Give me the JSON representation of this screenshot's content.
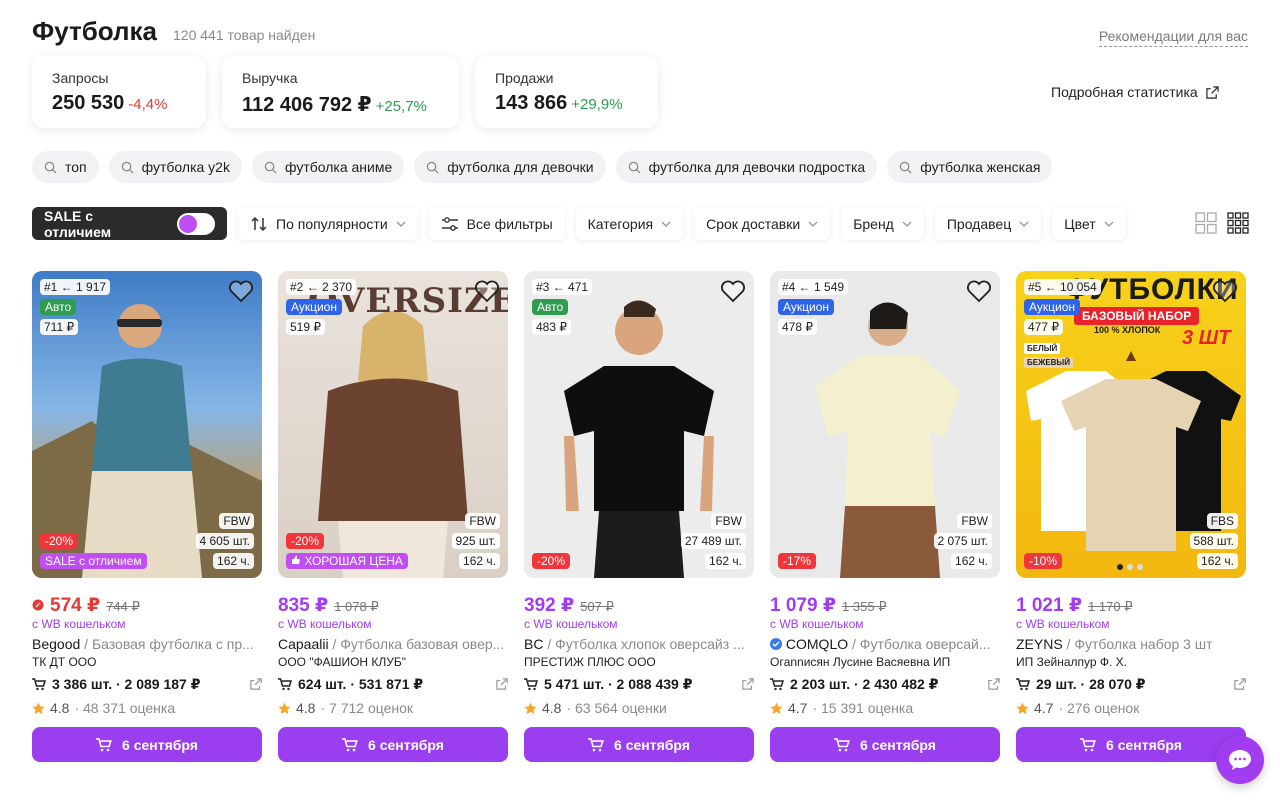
{
  "header": {
    "title": "Футболка",
    "found": "120 441 товар найден",
    "recommendations": "Рекомендации для вас"
  },
  "stats": [
    {
      "label": "Запросы",
      "value": "250 530",
      "change": "-4,4%"
    },
    {
      "label": "Выручка",
      "value": "112 406 792 ₽",
      "change": "+25,7%"
    },
    {
      "label": "Продажи",
      "value": "143 866",
      "change": "+29,9%"
    }
  ],
  "detailed_stats": "Подробная статистика",
  "chips": [
    "топ",
    "футболка y2k",
    "футболка аниме",
    "футболка для девочки",
    "футболка для девочки подростка",
    "футболка женская"
  ],
  "filters": {
    "sale_toggle": "SALE с отличием",
    "sort": "По популярности",
    "all_filters": "Все фильтры",
    "category": "Категория",
    "delivery": "Срок доставки",
    "brand": "Бренд",
    "seller": "Продавец",
    "color": "Цвет"
  },
  "products": [
    {
      "rank": "#1 ← 1 917",
      "promo": "Авто",
      "small_price": "711 ₽",
      "model": "FBW",
      "stock": "4 605 шт.",
      "hours": "162 ч.",
      "discount": "-20%",
      "badge": "SALE с отличием",
      "price": "574 ₽",
      "old_price": "744 ₽",
      "wallet": "с WB кошельком",
      "brand": "Begood",
      "name": "/ Базовая футболка с пр...",
      "seller": "ТК ДТ ООО",
      "sales": "3 386 шт. · 2 089 187 ₽",
      "rating": "4.8",
      "reviews": "· 48 371 оценка",
      "delivery": "6 сентября"
    },
    {
      "rank": "#2 ← 2 370",
      "promo": "Аукцион",
      "small_price": "519 ₽",
      "model": "FBW",
      "stock": "925 шт.",
      "hours": "162 ч.",
      "discount": "-20%",
      "badge": "ХОРОШАЯ ЦЕНА",
      "price": "835 ₽",
      "old_price": "1 078 ₽",
      "wallet": "с WB кошельком",
      "brand": "Capaalii",
      "name": "/ Футболка базовая овер...",
      "seller": "ООО \"ФАШИОН КЛУБ\"",
      "sales": "624 шт. · 531 871 ₽",
      "rating": "4.8",
      "reviews": "· 7 712 оценок",
      "delivery": "6 сентября",
      "banner": "OVERSIZE"
    },
    {
      "rank": "#3 ← 471",
      "promo": "Авто",
      "small_price": "483 ₽",
      "model": "FBW",
      "stock": "27 489 шт.",
      "hours": "162 ч.",
      "discount": "-20%",
      "price": "392 ₽",
      "old_price": "507 ₽",
      "wallet": "с WB кошельком",
      "brand": "BC",
      "name": "/ Футболка хлопок оверсайз ...",
      "seller": "ПРЕСТИЖ ПЛЮС ООО",
      "sales": "5 471 шт. · 2 088 439 ₽",
      "rating": "4.8",
      "reviews": "· 63 564 оценки",
      "delivery": "6 сентября"
    },
    {
      "rank": "#4 ← 1 549",
      "promo": "Аукцион",
      "small_price": "478 ₽",
      "model": "FBW",
      "stock": "2 075 шт.",
      "hours": "162 ч.",
      "discount": "-17%",
      "price": "1 079 ₽",
      "old_price": "1 355 ₽",
      "wallet": "с WB кошельком",
      "brand": "COMQLO",
      "name": "/ Футболка оверсай...",
      "seller": "Огannисян Лусине Васяевна ИП",
      "sales": "2 203 шт. · 2 430 482 ₽",
      "rating": "4.7",
      "reviews": "· 15 391 оценка",
      "delivery": "6 сентября"
    },
    {
      "rank": "#5 ← 10 054",
      "promo": "Аукцион",
      "small_price": "477 ₽",
      "model": "FBS",
      "stock": "588 шт.",
      "hours": "162 ч.",
      "discount": "-10%",
      "price": "1 021 ₽",
      "old_price": "1 170 ₽",
      "wallet": "с WB кошельком",
      "brand": "ZEYNS",
      "name": "/ Футболка набор 3 шт",
      "seller": "ИП Зейналпур Ф. Х.",
      "sales": "29 шт. · 28 070 ₽",
      "rating": "4.7",
      "reviews": "· 276 оценок",
      "delivery": "6 сентября",
      "banner_title": "ФУТБОЛКИ",
      "banner_sub": "БАЗОВЫЙ НАБОР",
      "banner_cotton": "100 % ХЛОПОК",
      "banner_count": "3 ШТ",
      "banner_white": "БЕЛЫЙ",
      "banner_beige": "БЕЖЕВЫЙ"
    }
  ],
  "colors": {
    "accent": "#9b3ef0",
    "price": "#a23cf0",
    "negative": "#e53935",
    "positive": "#2e9d4f",
    "auto_badge": "#2e9d4f",
    "auction_badge": "#2f64ea"
  }
}
